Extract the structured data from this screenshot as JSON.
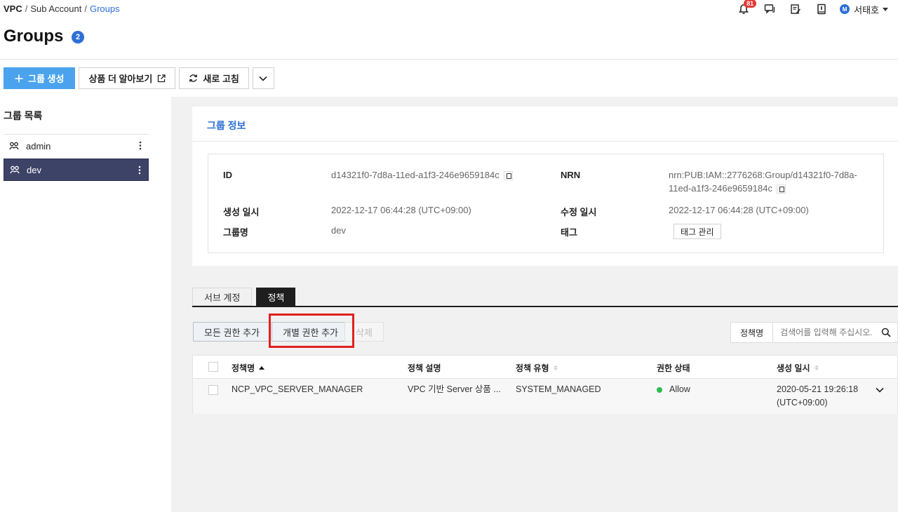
{
  "breadcrumb": {
    "root": "VPC",
    "sep1": "/",
    "mid": "Sub Account",
    "sep2": "/",
    "current": "Groups"
  },
  "header": {
    "notification_count": "81",
    "avatar_initial": "M",
    "user_name": "서태호"
  },
  "page": {
    "title": "Groups",
    "count": "2"
  },
  "toolbar": {
    "create_label": "그룹 생성",
    "learn_more_label": "상품 더 알아보기",
    "refresh_label": "새로 고침"
  },
  "group_list": {
    "title": "그룹 목록",
    "items": [
      {
        "name": "admin"
      },
      {
        "name": "dev"
      }
    ]
  },
  "group_info": {
    "title": "그룹 정보",
    "id_label": "ID",
    "id_value": "d14321f0-7d8a-11ed-a1f3-246e9659184c",
    "nrn_label": "NRN",
    "nrn_value_line1": "nrn:PUB:IAM::2776268:Group/d14321f0-7d8a-",
    "nrn_value_line2": "11ed-a1f3-246e9659184c",
    "created_label": "생성 일시",
    "created_value": "2022-12-17 06:44:28 (UTC+09:00)",
    "modified_label": "수정 일시",
    "modified_value": "2022-12-17 06:44:28 (UTC+09:00)",
    "name_label": "그룹명",
    "name_value": "dev",
    "tag_label": "태그",
    "tag_button": "태그 관리"
  },
  "tabs": [
    {
      "label": "서브 계정"
    },
    {
      "label": "정책"
    }
  ],
  "actions": {
    "add_all": "모든 권한 추가",
    "add_individual": "개별 권한 추가",
    "delete": "삭제"
  },
  "search": {
    "field": "정책명",
    "placeholder": "검색어를 입력해 주십시오."
  },
  "table": {
    "headers": {
      "name": "정책명",
      "description": "정책 설명",
      "type": "정책 유형",
      "status": "권한 상태",
      "created": "생성 일시"
    },
    "rows": [
      {
        "name": "NCP_VPC_SERVER_MANAGER",
        "description": "VPC 기반 Server 상품 ...",
        "type": "SYSTEM_MANAGED",
        "status": "Allow",
        "created_line1": "2020-05-21 19:26:18",
        "created_line2": "(UTC+09:00)"
      }
    ]
  },
  "colors": {
    "primary": "#4aa3ec",
    "accent": "#2d6fd6",
    "active_item": "#3d4366",
    "highlight": "#e02020",
    "allow": "#2ebd4e"
  }
}
